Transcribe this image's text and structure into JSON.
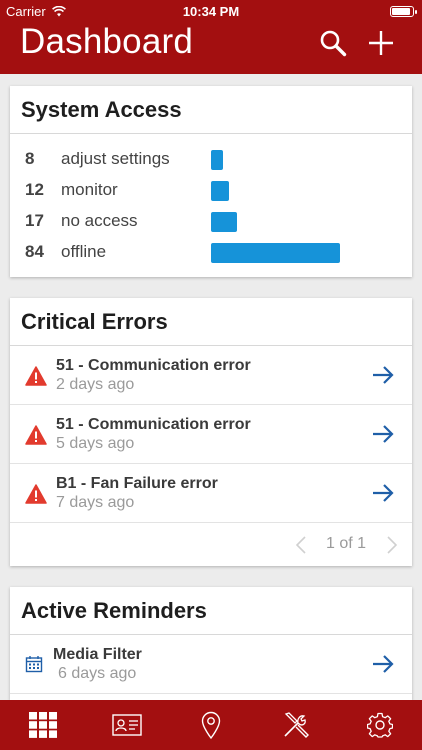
{
  "status_bar": {
    "carrier": "Carrier",
    "time": "10:34 PM"
  },
  "header": {
    "title": "Dashboard",
    "search_icon": "search-icon",
    "add_icon": "plus-icon"
  },
  "system_access": {
    "title": "System Access",
    "rows": [
      {
        "count": "8",
        "label": "adjust settings",
        "value": 8
      },
      {
        "count": "12",
        "label": "monitor",
        "value": 12
      },
      {
        "count": "17",
        "label": "no access",
        "value": 17
      },
      {
        "count": "84",
        "label": "offline",
        "value": 84
      }
    ],
    "bar_color": "#1693d9"
  },
  "critical_errors": {
    "title": "Critical Errors",
    "items": [
      {
        "title": "51 -  Communication error",
        "time": "2 days ago"
      },
      {
        "title": "51 -  Communication error",
        "time": "5 days ago"
      },
      {
        "title": "B1 - Fan Failure error",
        "time": "7 days ago"
      }
    ],
    "pager": "1 of 1",
    "warning_color": "#e23b2e"
  },
  "active_reminders": {
    "title": "Active Reminders",
    "items": [
      {
        "title": "Media Filter",
        "time": "6 days ago"
      }
    ]
  },
  "tab_bar": {
    "tabs": [
      "grid-icon",
      "id-card-icon",
      "location-pin-icon",
      "tools-icon",
      "gear-icon"
    ]
  },
  "colors": {
    "brand": "#a30f10",
    "link": "#1f5fa8"
  }
}
